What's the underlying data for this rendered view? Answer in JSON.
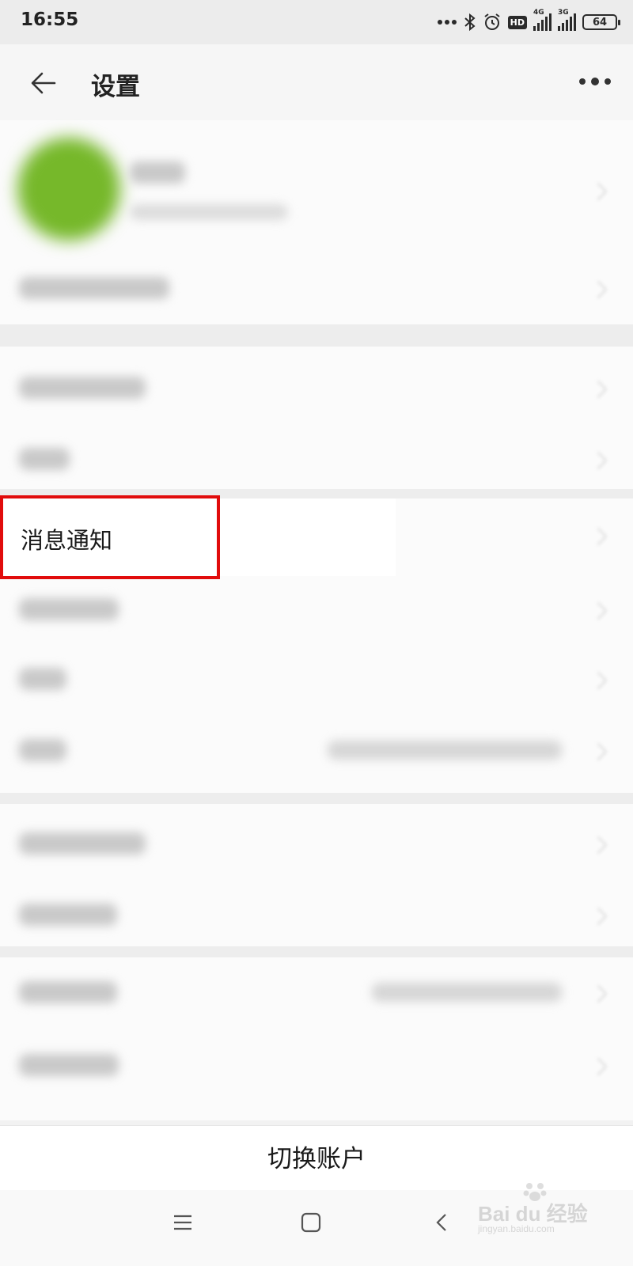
{
  "status_bar": {
    "time": "16:55",
    "icons": [
      "more-dots-icon",
      "bluetooth-icon",
      "alarm-icon",
      "hd-icon",
      "signal-4g-icon",
      "signal-3g-icon",
      "battery-icon"
    ],
    "hd_label": "HD",
    "network_1": "4G",
    "network_2": "3G",
    "battery_level": "64"
  },
  "header": {
    "title": "设置"
  },
  "settings": {
    "highlighted_item": "消息通知"
  },
  "footer": {
    "switch_account_label": "切换账户"
  },
  "watermark": {
    "brand_line": "Bai du 经验",
    "url": "jingyan.baidu.com"
  },
  "colors": {
    "highlight_border": "#e10c0c",
    "avatar_green": "#76b82a"
  }
}
